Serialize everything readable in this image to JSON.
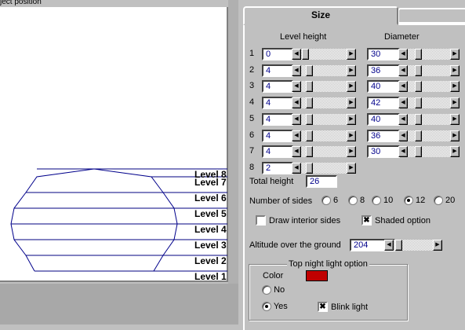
{
  "left_panel": {
    "title": "ject position",
    "level_labels": [
      "Level 8",
      "Level 7",
      "Level 6",
      "Level 5",
      "Level 4",
      "Level 3",
      "Level 2",
      "Level 1"
    ]
  },
  "tabs": {
    "active": "Size",
    "inactive": ""
  },
  "headers": {
    "level_height": "Level height",
    "diameter": "Diameter"
  },
  "rows": [
    {
      "num": "1",
      "height": "0",
      "diameter": "30"
    },
    {
      "num": "2",
      "height": "4",
      "diameter": "36"
    },
    {
      "num": "3",
      "height": "4",
      "diameter": "40"
    },
    {
      "num": "4",
      "height": "4",
      "diameter": "42"
    },
    {
      "num": "5",
      "height": "4",
      "diameter": "40"
    },
    {
      "num": "6",
      "height": "4",
      "diameter": "36"
    },
    {
      "num": "7",
      "height": "4",
      "diameter": "30"
    },
    {
      "num": "8",
      "height": "2",
      "diameter": ""
    }
  ],
  "total_height": {
    "label": "Total height",
    "value": "26"
  },
  "sides": {
    "label": "Number of  sides",
    "options": [
      "6",
      "8",
      "10",
      "12",
      "20"
    ],
    "selected": "12"
  },
  "draw_interior": {
    "label": "Draw interior sides",
    "checked": false
  },
  "shaded": {
    "label": "Shaded option",
    "checked": true
  },
  "altitude": {
    "label": "Altitude over the ground",
    "value": "204"
  },
  "night_light": {
    "title": "Top night light option",
    "color_label": "Color",
    "color": "#c00000",
    "no_label": "No",
    "yes_label": "Yes",
    "selected": "Yes",
    "blink_label": "Blink light",
    "blink_checked": true
  },
  "colors": {
    "shape_line": "#00008b",
    "level_line": "#000080"
  }
}
